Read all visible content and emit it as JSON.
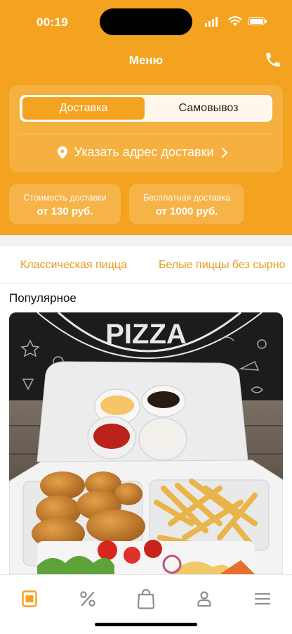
{
  "status_bar": {
    "time": "00:19"
  },
  "header": {
    "title": "Меню",
    "icon": "phone-icon"
  },
  "delivery_toggle": {
    "options": [
      "Доставка",
      "Самовывоз"
    ],
    "selected": "Доставка"
  },
  "address": {
    "label": "Указать адрес доставки",
    "icon": "location-pin-icon"
  },
  "info_chips": [
    {
      "caption": "Стоимость доставки",
      "value": "от 130 руб."
    },
    {
      "caption": "Бесплатная доставка",
      "value": "от 1000 руб."
    }
  ],
  "categories": [
    "Классическая пицца",
    "Белые пиццы без сырно"
  ],
  "section": {
    "title": "Популярное"
  },
  "photo": {
    "sign_text": "PIZZA"
  },
  "tab_bar": {
    "items": [
      "menu-icon",
      "percent-icon",
      "bag-icon",
      "profile-icon",
      "hamburger-icon"
    ],
    "active": "menu-icon"
  },
  "colors": {
    "accent": "#F4A320",
    "category_text": "#E99A1F"
  }
}
